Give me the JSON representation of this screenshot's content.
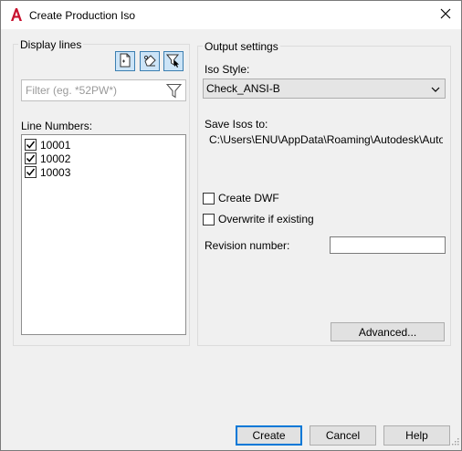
{
  "window": {
    "title": "Create Production Iso",
    "accent": "#0078d7",
    "app_icon_color": "#c8102e"
  },
  "display_lines": {
    "group_label": "Display lines",
    "tool_buttons": [
      "document-icon",
      "eraser-icon",
      "filter-cursor-icon"
    ],
    "filter_placeholder": "Filter (eg. *52PW*)",
    "line_numbers_label": "Line Numbers:",
    "items": [
      {
        "label": "10001",
        "checked": true
      },
      {
        "label": "10002",
        "checked": true
      },
      {
        "label": "10003",
        "checked": true
      }
    ]
  },
  "output": {
    "group_label": "Output settings",
    "iso_style_label": "Iso Style:",
    "iso_style_value": "Check_ANSI-B",
    "save_label": "Save Isos to:",
    "save_path": "C:\\Users\\ENU\\AppData\\Roaming\\Autodesk\\Autod...",
    "create_dwf_label": "Create DWF",
    "create_dwf_checked": false,
    "overwrite_label": "Overwrite if existing",
    "overwrite_checked": false,
    "revision_label": "Revision number:",
    "revision_value": "",
    "advanced_label": "Advanced..."
  },
  "footer": {
    "create_label": "Create",
    "cancel_label": "Cancel",
    "help_label": "Help"
  }
}
